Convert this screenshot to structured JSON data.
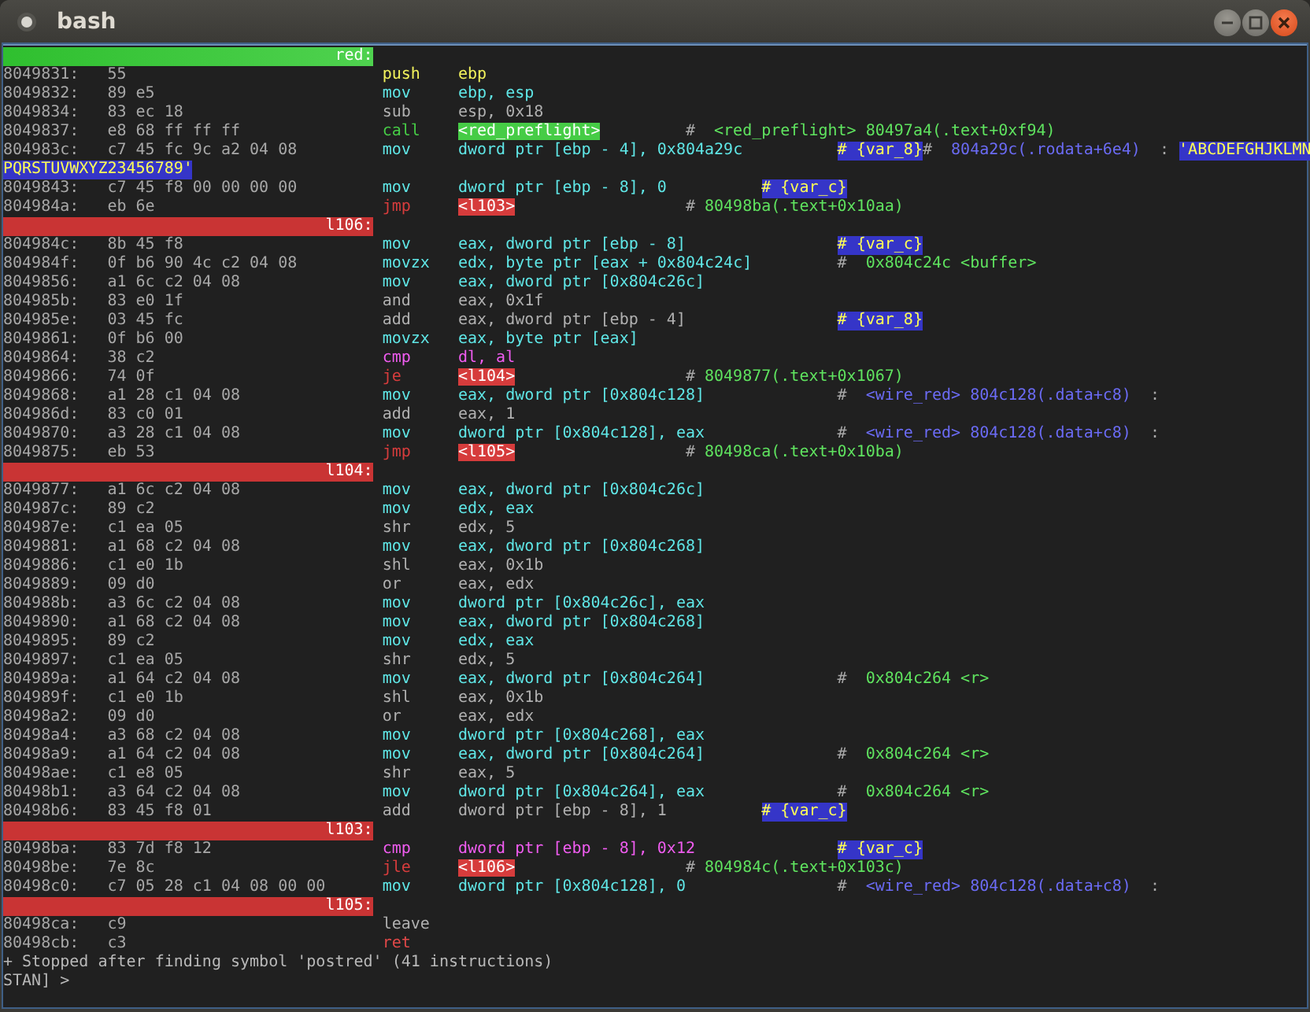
{
  "window": {
    "title": "bash"
  },
  "terminal": {
    "lines": [
      {
        "kind": "function_label",
        "text": "red:"
      },
      {
        "kind": "instruction",
        "address": "8049831:",
        "bytes": "55",
        "mnemonic": "push",
        "operands": "ebp",
        "color": "#f2f25c"
      },
      {
        "kind": "instruction",
        "address": "8049832:",
        "bytes": "89 e5",
        "mnemonic": "mov",
        "operands": "ebp, esp",
        "color": "#5fe6e6"
      },
      {
        "kind": "instruction",
        "address": "8049834:",
        "bytes": "83 ec 18",
        "mnemonic": "sub",
        "operands": "esp, 0x18",
        "color": "#b0b0b0"
      },
      {
        "kind": "branch",
        "address": "8049837:",
        "bytes": "e8 68 ff ff ff",
        "mnemonic": "call",
        "operands": "<red_preflight>",
        "color": "#46cc46",
        "comment": [
          {
            "kind": "plain",
            "text": "#"
          },
          {
            "kind": "ref",
            "text": "<red_preflight> 80497a4(.text+0xf94)"
          }
        ]
      },
      {
        "kind": "instruction",
        "address": "804983c:",
        "bytes": "c7 45 fc 9c a2 04 08",
        "mnemonic": "mov",
        "operands": "dword ptr [ebp - 4], 0x804a29c",
        "color": "#5fe6e6",
        "comment": [
          {
            "kind": "var",
            "text": "# {var_8}"
          },
          {
            "kind": "plain",
            "text": "#"
          },
          {
            "kind": "sym",
            "text": "804a29c(.rodata+6e4)"
          },
          {
            "kind": "plain",
            "text": ":"
          },
          {
            "kind": "string",
            "text": "'ABCDEFGHJKLMN"
          }
        ]
      },
      {
        "kind": "continuation",
        "text": "PQRSTUVWXYZ23456789'"
      },
      {
        "kind": "instruction",
        "address": "8049843:",
        "bytes": "c7 45 f8 00 00 00 00",
        "mnemonic": "mov",
        "operands": "dword ptr [ebp - 8], 0",
        "color": "#5fe6e6",
        "comment": [
          {
            "kind": "var",
            "text": "# {var_c}"
          }
        ]
      },
      {
        "kind": "branch",
        "address": "804984a:",
        "bytes": "eb 6e",
        "mnemonic": "jmp",
        "operands": "<l103>",
        "color": "#d63c3c",
        "comment": [
          {
            "kind": "plain",
            "text": "#"
          },
          {
            "kind": "ref",
            "text": "80498ba(.text+0x10aa)"
          }
        ]
      },
      {
        "kind": "label",
        "text": "l106:"
      },
      {
        "kind": "instruction",
        "address": "804984c:",
        "bytes": "8b 45 f8",
        "mnemonic": "mov",
        "operands": "eax, dword ptr [ebp - 8]",
        "color": "#5fe6e6",
        "comment": [
          {
            "kind": "var",
            "text": "# {var_c}"
          }
        ]
      },
      {
        "kind": "instruction",
        "address": "804984f:",
        "bytes": "0f b6 90 4c c2 04 08",
        "mnemonic": "movzx",
        "operands": "edx, byte ptr [eax + 0x804c24c]",
        "color": "#5fe6e6",
        "comment": [
          {
            "kind": "plain",
            "text": "#"
          },
          {
            "kind": "ref",
            "text": "0x804c24c <buffer>"
          }
        ]
      },
      {
        "kind": "instruction",
        "address": "8049856:",
        "bytes": "a1 6c c2 04 08",
        "mnemonic": "mov",
        "operands": "eax, dword ptr [0x804c26c]",
        "color": "#5fe6e6"
      },
      {
        "kind": "instruction",
        "address": "804985b:",
        "bytes": "83 e0 1f",
        "mnemonic": "and",
        "operands": "eax, 0x1f",
        "color": "#b0b0b0"
      },
      {
        "kind": "instruction",
        "address": "804985e:",
        "bytes": "03 45 fc",
        "mnemonic": "add",
        "operands": "eax, dword ptr [ebp - 4]",
        "color": "#b0b0b0",
        "comment": [
          {
            "kind": "var",
            "text": "# {var_8}"
          }
        ]
      },
      {
        "kind": "instruction",
        "address": "8049861:",
        "bytes": "0f b6 00",
        "mnemonic": "movzx",
        "operands": "eax, byte ptr [eax]",
        "color": "#5fe6e6"
      },
      {
        "kind": "instruction",
        "address": "8049864:",
        "bytes": "38 c2",
        "mnemonic": "cmp",
        "operands": "dl, al",
        "color": "#f05cf0"
      },
      {
        "kind": "branch",
        "address": "8049866:",
        "bytes": "74 0f",
        "mnemonic": "je",
        "operands": "<l104>",
        "color": "#d63c3c",
        "comment": [
          {
            "kind": "plain",
            "text": "#"
          },
          {
            "kind": "ref",
            "text": "8049877(.text+0x1067)"
          }
        ]
      },
      {
        "kind": "instruction",
        "address": "8049868:",
        "bytes": "a1 28 c1 04 08",
        "mnemonic": "mov",
        "operands": "eax, dword ptr [0x804c128]",
        "color": "#5fe6e6",
        "comment": [
          {
            "kind": "plain",
            "text": "#"
          },
          {
            "kind": "sym",
            "text": "<wire_red> 804c128(.data+c8)"
          },
          {
            "kind": "plain",
            "text": ":"
          }
        ]
      },
      {
        "kind": "instruction",
        "address": "804986d:",
        "bytes": "83 c0 01",
        "mnemonic": "add",
        "operands": "eax, 1",
        "color": "#b0b0b0"
      },
      {
        "kind": "instruction",
        "address": "8049870:",
        "bytes": "a3 28 c1 04 08",
        "mnemonic": "mov",
        "operands": "dword ptr [0x804c128], eax",
        "color": "#5fe6e6",
        "comment": [
          {
            "kind": "plain",
            "text": "#"
          },
          {
            "kind": "sym",
            "text": "<wire_red> 804c128(.data+c8)"
          },
          {
            "kind": "plain",
            "text": ":"
          }
        ]
      },
      {
        "kind": "branch",
        "address": "8049875:",
        "bytes": "eb 53",
        "mnemonic": "jmp",
        "operands": "<l105>",
        "color": "#d63c3c",
        "comment": [
          {
            "kind": "plain",
            "text": "#"
          },
          {
            "kind": "ref",
            "text": "80498ca(.text+0x10ba)"
          }
        ]
      },
      {
        "kind": "label",
        "text": "l104:"
      },
      {
        "kind": "instruction",
        "address": "8049877:",
        "bytes": "a1 6c c2 04 08",
        "mnemonic": "mov",
        "operands": "eax, dword ptr [0x804c26c]",
        "color": "#5fe6e6"
      },
      {
        "kind": "instruction",
        "address": "804987c:",
        "bytes": "89 c2",
        "mnemonic": "mov",
        "operands": "edx, eax",
        "color": "#5fe6e6"
      },
      {
        "kind": "instruction",
        "address": "804987e:",
        "bytes": "c1 ea 05",
        "mnemonic": "shr",
        "operands": "edx, 5",
        "color": "#b0b0b0"
      },
      {
        "kind": "instruction",
        "address": "8049881:",
        "bytes": "a1 68 c2 04 08",
        "mnemonic": "mov",
        "operands": "eax, dword ptr [0x804c268]",
        "color": "#5fe6e6"
      },
      {
        "kind": "instruction",
        "address": "8049886:",
        "bytes": "c1 e0 1b",
        "mnemonic": "shl",
        "operands": "eax, 0x1b",
        "color": "#b0b0b0"
      },
      {
        "kind": "instruction",
        "address": "8049889:",
        "bytes": "09 d0",
        "mnemonic": "or",
        "operands": "eax, edx",
        "color": "#b0b0b0"
      },
      {
        "kind": "instruction",
        "address": "804988b:",
        "bytes": "a3 6c c2 04 08",
        "mnemonic": "mov",
        "operands": "dword ptr [0x804c26c], eax",
        "color": "#5fe6e6"
      },
      {
        "kind": "instruction",
        "address": "8049890:",
        "bytes": "a1 68 c2 04 08",
        "mnemonic": "mov",
        "operands": "eax, dword ptr [0x804c268]",
        "color": "#5fe6e6"
      },
      {
        "kind": "instruction",
        "address": "8049895:",
        "bytes": "89 c2",
        "mnemonic": "mov",
        "operands": "edx, eax",
        "color": "#5fe6e6"
      },
      {
        "kind": "instruction",
        "address": "8049897:",
        "bytes": "c1 ea 05",
        "mnemonic": "shr",
        "operands": "edx, 5",
        "color": "#b0b0b0"
      },
      {
        "kind": "instruction",
        "address": "804989a:",
        "bytes": "a1 64 c2 04 08",
        "mnemonic": "mov",
        "operands": "eax, dword ptr [0x804c264]",
        "color": "#5fe6e6",
        "comment": [
          {
            "kind": "plain",
            "text": "#"
          },
          {
            "kind": "ref",
            "text": "0x804c264 <r>"
          }
        ]
      },
      {
        "kind": "instruction",
        "address": "804989f:",
        "bytes": "c1 e0 1b",
        "mnemonic": "shl",
        "operands": "eax, 0x1b",
        "color": "#b0b0b0"
      },
      {
        "kind": "instruction",
        "address": "80498a2:",
        "bytes": "09 d0",
        "mnemonic": "or",
        "operands": "eax, edx",
        "color": "#b0b0b0"
      },
      {
        "kind": "instruction",
        "address": "80498a4:",
        "bytes": "a3 68 c2 04 08",
        "mnemonic": "mov",
        "operands": "dword ptr [0x804c268], eax",
        "color": "#5fe6e6"
      },
      {
        "kind": "instruction",
        "address": "80498a9:",
        "bytes": "a1 64 c2 04 08",
        "mnemonic": "mov",
        "operands": "eax, dword ptr [0x804c264]",
        "color": "#5fe6e6",
        "comment": [
          {
            "kind": "plain",
            "text": "#"
          },
          {
            "kind": "ref",
            "text": "0x804c264 <r>"
          }
        ]
      },
      {
        "kind": "instruction",
        "address": "80498ae:",
        "bytes": "c1 e8 05",
        "mnemonic": "shr",
        "operands": "eax, 5",
        "color": "#b0b0b0"
      },
      {
        "kind": "instruction",
        "address": "80498b1:",
        "bytes": "a3 64 c2 04 08",
        "mnemonic": "mov",
        "operands": "dword ptr [0x804c264], eax",
        "color": "#5fe6e6",
        "comment": [
          {
            "kind": "plain",
            "text": "#"
          },
          {
            "kind": "ref",
            "text": "0x804c264 <r>"
          }
        ]
      },
      {
        "kind": "instruction",
        "address": "80498b6:",
        "bytes": "83 45 f8 01",
        "mnemonic": "add",
        "operands": "dword ptr [ebp - 8], 1",
        "color": "#b0b0b0",
        "comment": [
          {
            "kind": "var",
            "text": "# {var_c}"
          }
        ]
      },
      {
        "kind": "label",
        "text": "l103:"
      },
      {
        "kind": "instruction",
        "address": "80498ba:",
        "bytes": "83 7d f8 12",
        "mnemonic": "cmp",
        "operands": "dword ptr [ebp - 8], 0x12",
        "color": "#f05cf0",
        "comment": [
          {
            "kind": "var",
            "text": "# {var_c}"
          }
        ]
      },
      {
        "kind": "branch",
        "address": "80498be:",
        "bytes": "7e 8c",
        "mnemonic": "jle",
        "operands": "<l106>",
        "color": "#d63c3c",
        "comment": [
          {
            "kind": "plain",
            "text": "#"
          },
          {
            "kind": "ref",
            "text": "804984c(.text+0x103c)"
          }
        ]
      },
      {
        "kind": "instruction",
        "address": "80498c0:",
        "bytes": "c7 05 28 c1 04 08 00 00",
        "mnemonic": "mov",
        "operands": "dword ptr [0x804c128], 0",
        "color": "#5fe6e6",
        "comment": [
          {
            "kind": "plain",
            "text": "#"
          },
          {
            "kind": "sym",
            "text": "<wire_red> 804c128(.data+c8)"
          },
          {
            "kind": "plain",
            "text": ":"
          }
        ]
      },
      {
        "kind": "label",
        "text": "l105:"
      },
      {
        "kind": "instruction",
        "address": "80498ca:",
        "bytes": "c9",
        "mnemonic": "leave",
        "color": "#b0b0b0"
      },
      {
        "kind": "instruction",
        "address": "80498cb:",
        "bytes": "c3",
        "mnemonic": "ret",
        "color": "#e04848"
      },
      {
        "kind": "message",
        "text": "+ Stopped after finding symbol 'postred' (41 instructions)"
      },
      {
        "kind": "message",
        "text": "STAN] >"
      }
    ]
  }
}
